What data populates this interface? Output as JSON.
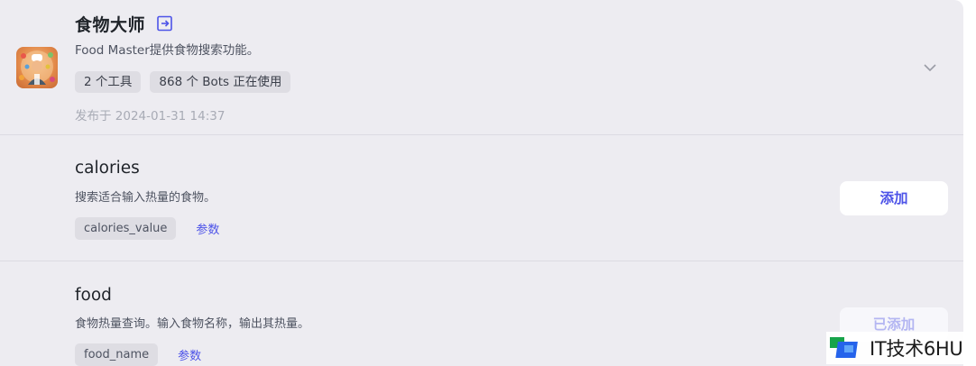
{
  "plugin": {
    "title": "食物大师",
    "description": "Food Master提供食物搜索功能。",
    "tags": [
      "2 个工具",
      "868 个 Bots 正在使用"
    ],
    "published": "发布于 2024-01-31 14:37"
  },
  "tools": [
    {
      "name": "calories",
      "description": "搜索适合输入热量的食物。",
      "param": "calories_value",
      "param_link": "参数",
      "button": "添加",
      "state": "add"
    },
    {
      "name": "food",
      "description": "食物热量查询。输入食物名称，输出其热量。",
      "param": "food_name",
      "param_link": "参数",
      "button": "已添加",
      "state": "added"
    }
  ],
  "watermark": {
    "text": "IT技术6HU"
  },
  "colors": {
    "accent": "#4d53e8",
    "panel_bg": "#edecf1",
    "disabled_button_text": "#b4b6f2"
  }
}
